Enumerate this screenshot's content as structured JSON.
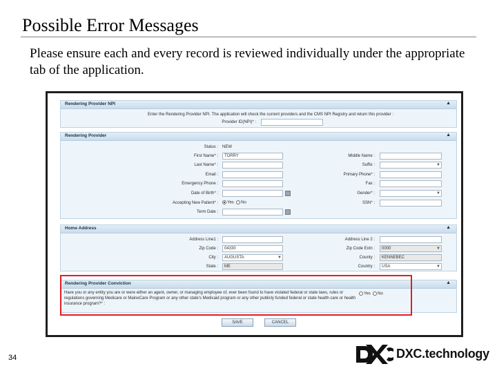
{
  "slide": {
    "title": "Possible Error Messages",
    "subtitle": "Please ensure each and every record is reviewed individually under the appropriate tab of the application.",
    "page_number": "34"
  },
  "logo": {
    "text": "DXC.technology",
    "color": "#111111"
  },
  "screenshot": {
    "npi_panel": {
      "title": "Rendering Provider NPI",
      "instruction": "Enter the Rendering Provider NPI. The application will check the current providers and the CMS NPI Registry and return this provider :",
      "provider_id_label": "Provider ID(NPI)* :",
      "provider_id_value": ""
    },
    "provider_panel": {
      "title": "Rendering Provider",
      "status_label": "Status :",
      "status_value": "NEW",
      "first_name_label": "First Name* :",
      "first_name_value": "TORRY",
      "last_name_label": "Last Name* :",
      "email_label": "Email :",
      "emergency_phone_label": "Emergency Phone :",
      "dob_label": "Date of Birth* :",
      "accepting_label": "Accepting New Patient* :",
      "accepting_yes": "Yes",
      "accepting_no": "No",
      "term_date_label": "Term Date :",
      "middle_name_label": "Middle Name :",
      "suffix_label": "Suffix :",
      "primary_phone_label": "Primary Phone* :",
      "fax_label": "Fax :",
      "gender_label": "Gender* :",
      "ssn_label": "SSN* :"
    },
    "address_panel": {
      "title": "Home Address",
      "address1_label": "Address Line1 :",
      "zip_label": "Zip Code :",
      "zip_value": "04330",
      "city_label": "City :",
      "city_value": "AUGUSTA",
      "state_label": "State :",
      "state_value": "ME",
      "address2_label": "Address Line 2 :",
      "zip_ext_label": "Zip Code Extn :",
      "zip_ext_value": "0000",
      "county_label": "County :",
      "county_value": "KENNEBEC",
      "country_label": "Country :",
      "country_value": "USA"
    },
    "conviction_panel": {
      "title": "Rendering Provider Conviction",
      "question": "Have you or any entity you are or were either an agent, owner, or managing employee of, ever been found to have violated federal or state laws, rules or regulations governing Medicare or MaineCare Program or any other state's Medicaid program or any other publicly funded federal or state health care or health insurance program?* :",
      "yes": "Yes",
      "no": "No"
    },
    "buttons": {
      "save": "SAVE",
      "cancel": "CANCEL"
    },
    "highlight_color": "#e31b23"
  }
}
